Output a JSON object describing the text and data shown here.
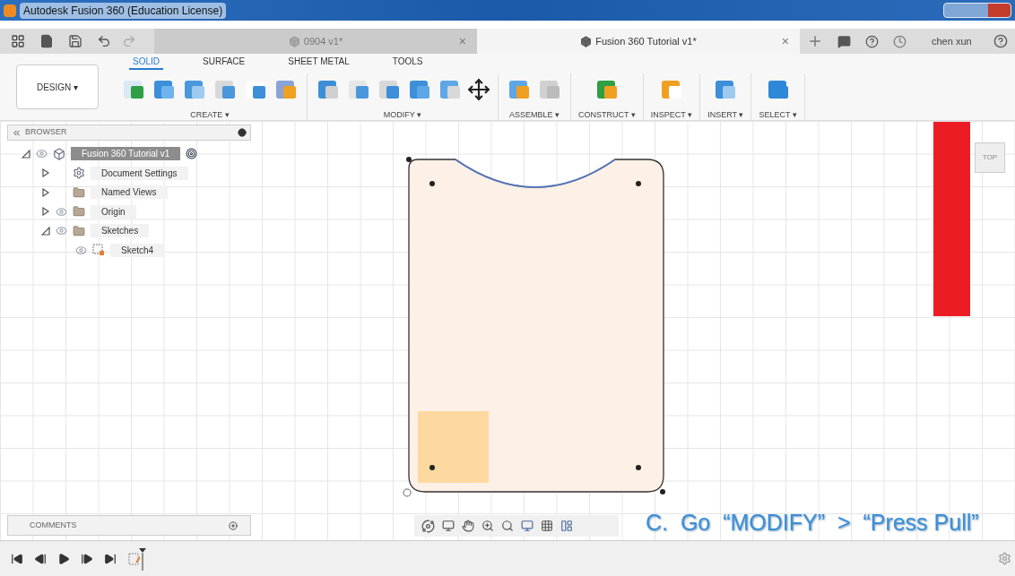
{
  "window": {
    "title": "Autodesk Fusion 360 (Education License)"
  },
  "doc_tabs": [
    {
      "label": "0904 v1*",
      "selected": false,
      "close": "×"
    },
    {
      "label": "Fusion 360 Tutorial v1*",
      "selected": true,
      "close": "×"
    }
  ],
  "user": "chen xun",
  "workspace": {
    "label": "DESIGN ▾"
  },
  "toolbar_tabs": [
    {
      "label": "SOLID",
      "selected": true
    },
    {
      "label": "SURFACE",
      "selected": false
    },
    {
      "label": "SHEET METAL",
      "selected": false
    },
    {
      "label": "TOOLS",
      "selected": false
    }
  ],
  "tool_groups": [
    {
      "label": "CREATE ▾"
    },
    {
      "label": "MODIFY ▾"
    },
    {
      "label": "ASSEMBLE ▾"
    },
    {
      "label": "CONSTRUCT ▾"
    },
    {
      "label": "INSPECT ▾"
    },
    {
      "label": "INSERT ▾"
    },
    {
      "label": "SELECT ▾"
    }
  ],
  "browser": {
    "title": "BROWSER",
    "tree": [
      {
        "label": "Fusion 360 Tutorial v1",
        "kind": "component",
        "selected": true,
        "expanded": true,
        "children": [
          {
            "label": "Document Settings",
            "kind": "settings",
            "selected": false,
            "expanded": false
          },
          {
            "label": "Named Views",
            "kind": "folder",
            "selected": false,
            "expanded": false
          },
          {
            "label": "Origin",
            "kind": "folder",
            "selected": false,
            "expanded": false
          },
          {
            "label": "Sketches",
            "kind": "folder",
            "selected": false,
            "expanded": true,
            "children": [
              {
                "label": "Sketch4",
                "kind": "sketch",
                "selected": false
              }
            ]
          }
        ]
      }
    ]
  },
  "view_cube": {
    "label": "TOP"
  },
  "comments": {
    "title": "COMMENTS"
  },
  "caption": "C.  Go  “MODIFY”  >  “Press Pull”"
}
